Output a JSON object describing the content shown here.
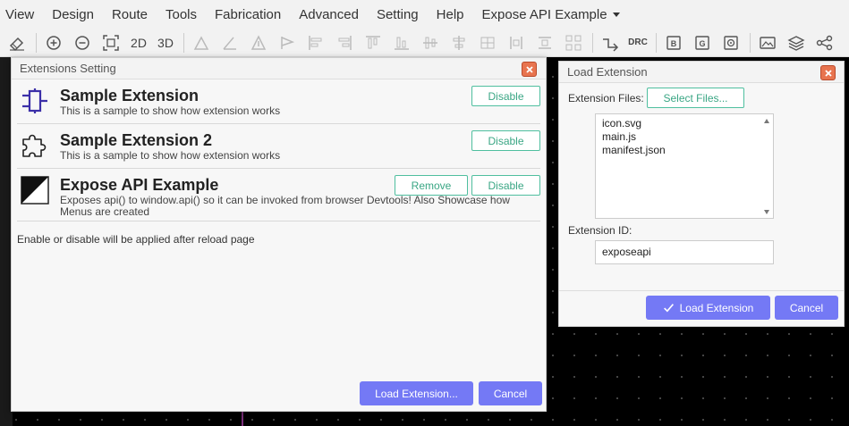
{
  "menubar": {
    "items": [
      "View",
      "Design",
      "Route",
      "Tools",
      "Fabrication",
      "Advanced",
      "Setting",
      "Help",
      "Expose API Example"
    ]
  },
  "toolbar": {
    "label_2d": "2D",
    "label_3d": "3D",
    "label_drc": "DRC",
    "icons": [
      "eraser-icon",
      "zoom-in-icon",
      "zoom-out-icon",
      "fit-view-icon",
      "view-2d",
      "view-3d",
      "align-icons",
      "route-icon",
      "drc-icon",
      "b-icon",
      "g-icon",
      "target-icon",
      "image-icon",
      "layers-icon",
      "share-icon"
    ]
  },
  "extensions_dialog": {
    "title": "Extensions Setting",
    "extensions": [
      {
        "name": "Sample Extension",
        "description": "This is a sample to show how extension works",
        "disable_label": "Disable"
      },
      {
        "name": "Sample Extension 2",
        "description": "This is a sample to show how extension works",
        "disable_label": "Disable"
      },
      {
        "name": "Expose API Example",
        "description": "Exposes api() to window.api() so it can be invoked from browser Devtools! Also Showcase how Menus are created",
        "remove_label": "Remove",
        "disable_label": "Disable"
      }
    ],
    "note": "Enable or disable will be applied after reload page",
    "load_button": "Load Extension...",
    "cancel_button": "Cancel"
  },
  "load_dialog": {
    "title": "Load Extension",
    "files_label": "Extension Files:",
    "select_button": "Select Files...",
    "files": [
      "icon.svg",
      "main.js",
      "manifest.json"
    ],
    "id_label": "Extension ID:",
    "id_value": "exposeapi",
    "load_button": "Load Extension",
    "cancel_button": "Cancel"
  },
  "colors": {
    "primary": "#7479f5",
    "accent_outline": "#4fbf9f",
    "close": "#e8744f"
  }
}
